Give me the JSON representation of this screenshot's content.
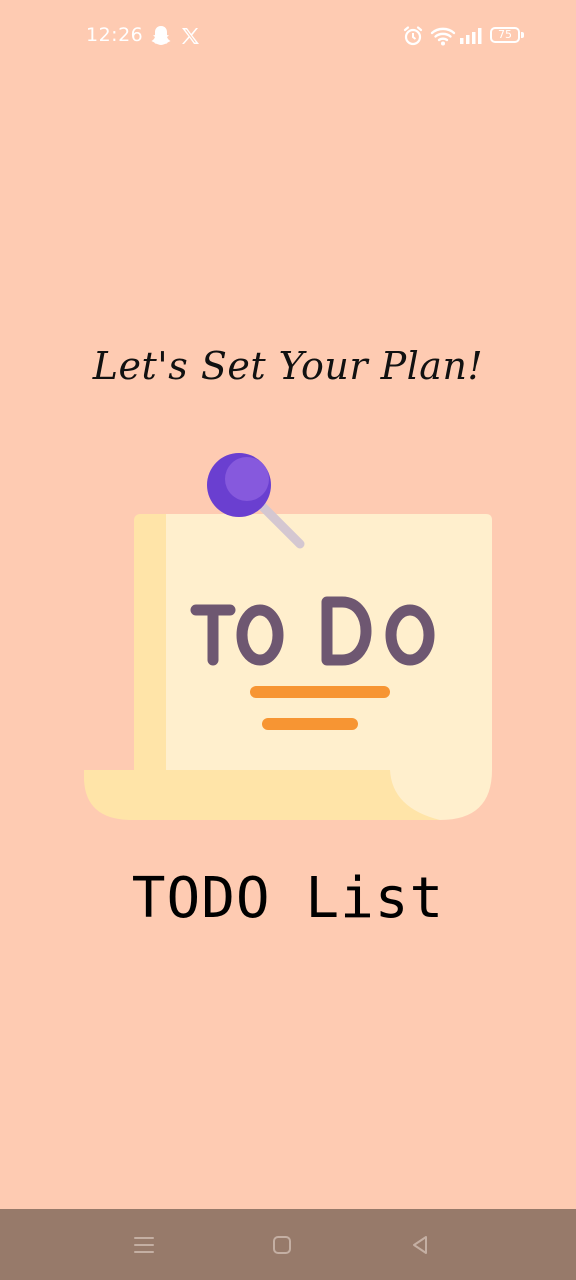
{
  "status_bar": {
    "time": "12:26",
    "battery": "75",
    "icons": [
      "snapchat-icon",
      "x-icon",
      "alarm-icon",
      "wifi-icon",
      "signal-icon",
      "battery-icon"
    ]
  },
  "screen": {
    "tagline": "Let's Set Your Plan!",
    "illustration_text": "TODO",
    "title": "TODO List"
  },
  "colors": {
    "background": "#FECBB2",
    "paper": "#FFEFCD",
    "paper_shade": "#FFE4A8",
    "pin": "#7B4FD8",
    "todo_text": "#6E5771",
    "lines": "#F79533",
    "nav_bar": "#977A6A"
  },
  "nav": {
    "icons": [
      "menu-icon",
      "home-square-icon",
      "back-triangle-icon"
    ]
  }
}
